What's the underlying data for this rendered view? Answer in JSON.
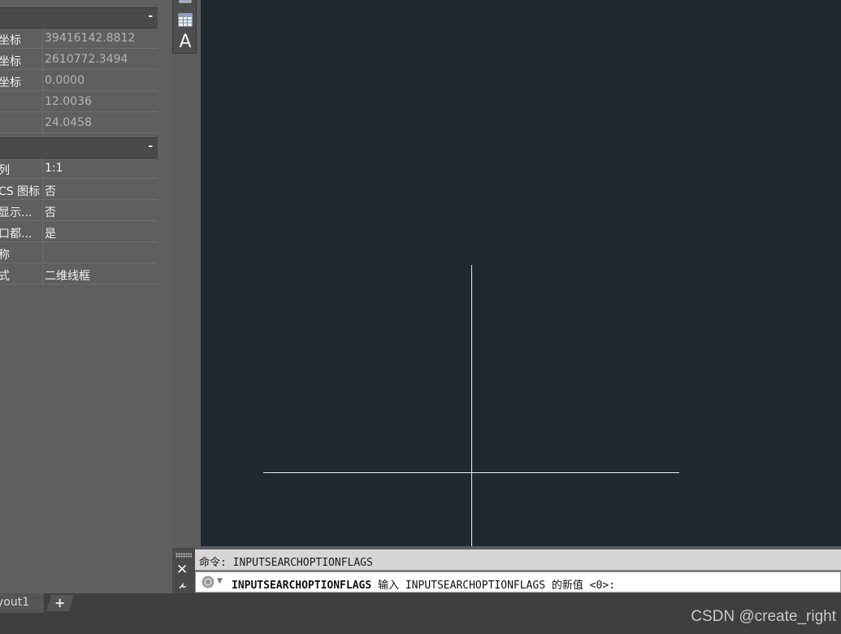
{
  "properties": {
    "sections": [
      {
        "collapse_symbol": "-",
        "rows": [
          {
            "name": "坐标",
            "value": "39416142.8812",
            "style": "gray"
          },
          {
            "name": "坐标",
            "value": "2610772.3494",
            "style": "gray"
          },
          {
            "name": "坐标",
            "value": "0.0000",
            "style": "gray"
          },
          {
            "name": "",
            "value": "12.0036",
            "style": "gray"
          },
          {
            "name": "",
            "value": "24.0458",
            "style": "gray"
          }
        ]
      },
      {
        "collapse_symbol": "-",
        "rows": [
          {
            "name": "列",
            "value": "1:1",
            "style": "white"
          },
          {
            "name": "CS 图标",
            "value": "否",
            "style": "white"
          },
          {
            "name": "显示...",
            "value": "否",
            "style": "white"
          },
          {
            "name": "口都...",
            "value": "是",
            "style": "white"
          },
          {
            "name": "称",
            "value": "",
            "style": "white"
          },
          {
            "name": "式",
            "value": "二维线框",
            "style": "white"
          }
        ]
      }
    ]
  },
  "toolbar": {
    "icons": [
      "print-icon",
      "table-icon",
      "text-icon"
    ],
    "text_glyph": "A"
  },
  "command_line": {
    "close_symbol": "✕",
    "history": "命令: INPUTSEARCHOPTIONFLAGS",
    "prompt_keyword": "INPUTSEARCHOPTIONFLAGS",
    "prompt_text": " 输入 INPUTSEARCHOPTIONFLAGS 的新值 <0>:",
    "menu_arrow": "▼"
  },
  "tabs": {
    "layout_tab": "yout1",
    "add_symbol": "+"
  },
  "watermark": "CSDN @create_right",
  "colors": {
    "canvas_bg": "#212830",
    "crosshair": "#e8e8e8",
    "panel_bg": "#5f5f5f"
  }
}
